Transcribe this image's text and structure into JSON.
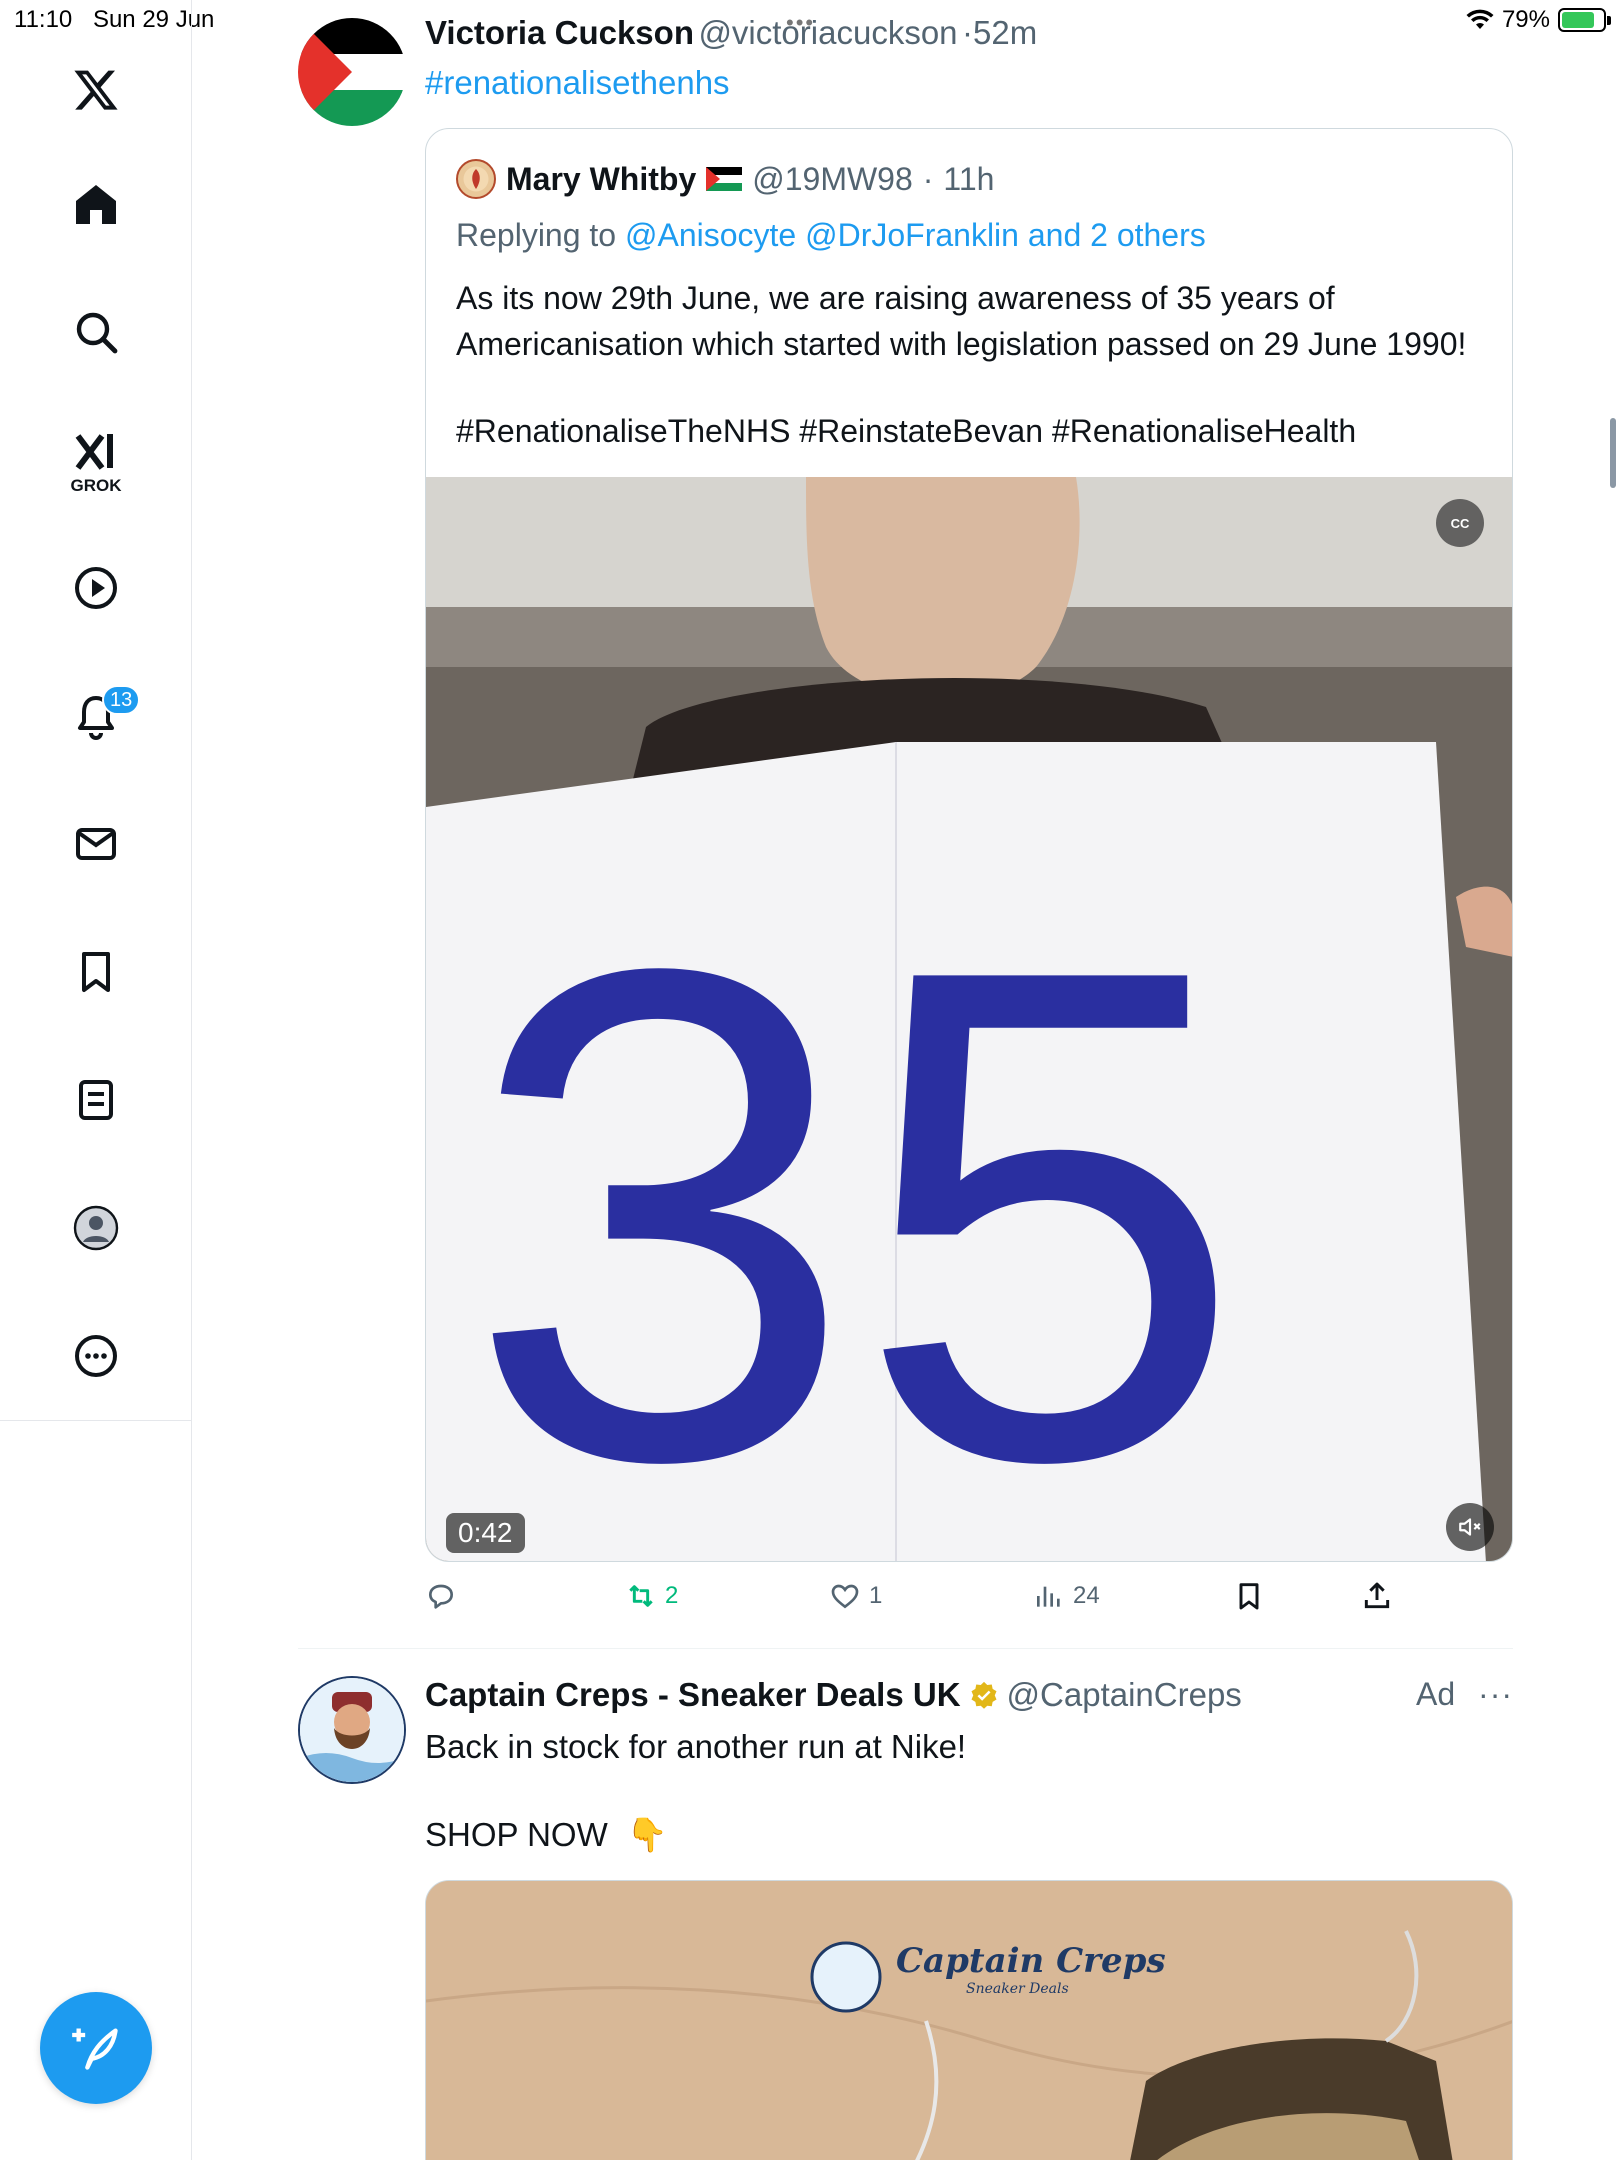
{
  "status_bar": {
    "time": "11:10",
    "date": "Sun 29 Jun",
    "battery": "79%",
    "battery_level": 0.79
  },
  "sidebar": {
    "grok_label": "GROK",
    "notification_count": "13"
  },
  "tweet1": {
    "name": "Victoria Cuckson",
    "handle": "@victoriacuckson",
    "time": "52m",
    "hashtag": "#renationalisethenhs",
    "quote": {
      "name": "Mary Whitby",
      "handle": "@19MW98",
      "time": "11h",
      "replying_prefix": "Replying to",
      "replying_to": "@Anisocyte @DrJoFranklin and 2 others",
      "text": "As its  now 29th June, we are raising awareness of 35 years of Americanisation which started with legislation passed on 29 June 1990!",
      "hashtags": "#RenationaliseTheNHS #ReinstateBevan #RenationaliseHealth",
      "video_sign": "35",
      "video_duration": "0:42",
      "cc_label": "CC"
    },
    "actions": {
      "retweets": "2",
      "likes": "1",
      "views": "24"
    }
  },
  "tweet2": {
    "name": "Captain Creps - Sneaker Deals UK",
    "handle": "@CaptainCreps",
    "ad_label": "Ad",
    "text": "Back in stock for another run at Nike!",
    "shop_now": "SHOP NOW",
    "shop_emoji": "👇",
    "image_logo": "Captain Creps",
    "image_logo_sub": "Sneaker Deals"
  },
  "colors": {
    "accent": "#1d9bf0",
    "retweet_green": "#00ba7c",
    "muted_text": "#536471"
  }
}
